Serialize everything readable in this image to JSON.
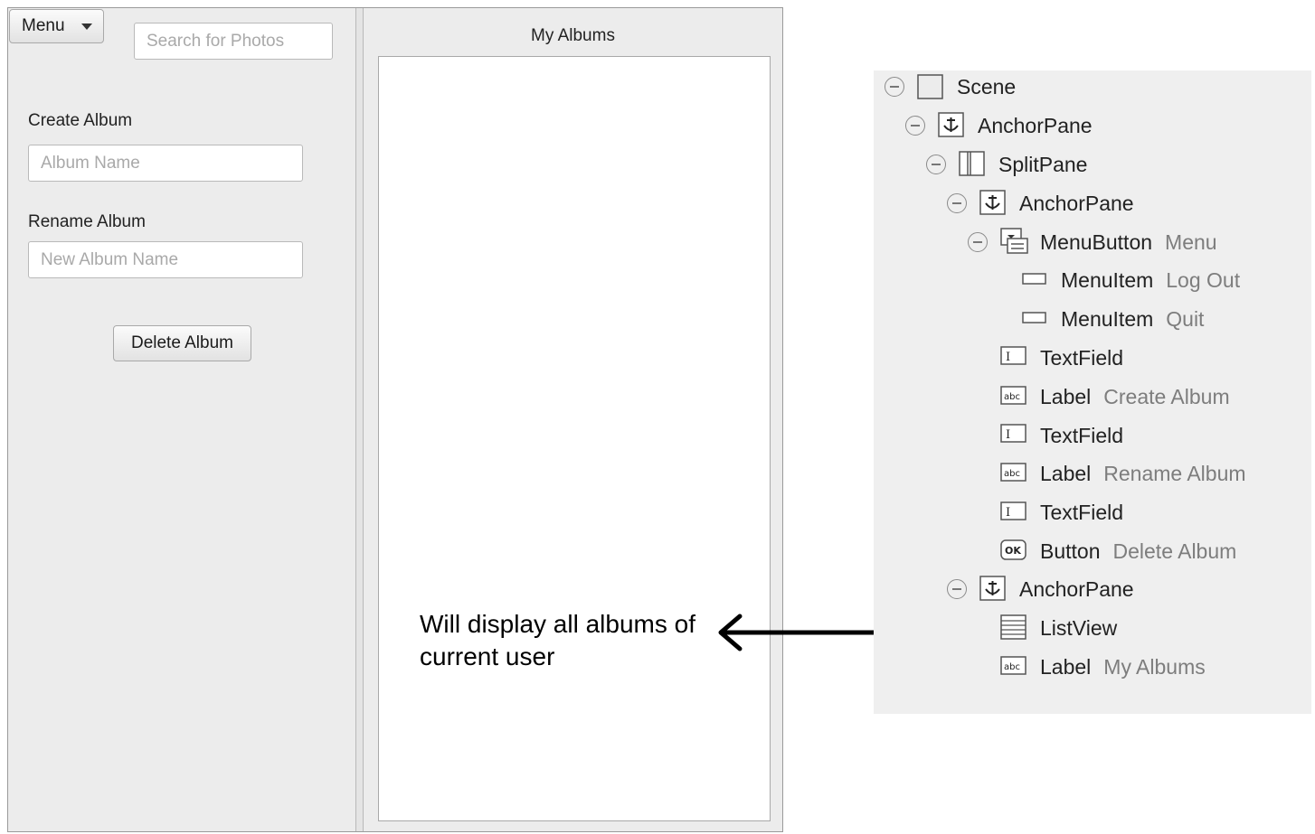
{
  "app": {
    "menu_label": "Menu",
    "search_placeholder": "Search for Photos",
    "create_label": "Create Album",
    "album_name_placeholder": "Album Name",
    "rename_label": "Rename Album",
    "new_album_placeholder": "New Album Name",
    "delete_label": "Delete Album",
    "albums_title": "My Albums"
  },
  "annotation": {
    "line1": "Will display all albums of",
    "line2": "current user"
  },
  "hierarchy": {
    "rows": [
      {
        "name": "Scene",
        "sub": ""
      },
      {
        "name": "AnchorPane",
        "sub": ""
      },
      {
        "name": "SplitPane",
        "sub": ""
      },
      {
        "name": "AnchorPane",
        "sub": ""
      },
      {
        "name": "MenuButton",
        "sub": "Menu"
      },
      {
        "name": "MenuItem",
        "sub": "Log Out"
      },
      {
        "name": "MenuItem",
        "sub": "Quit"
      },
      {
        "name": "TextField",
        "sub": ""
      },
      {
        "name": "Label",
        "sub": "Create Album"
      },
      {
        "name": "TextField",
        "sub": ""
      },
      {
        "name": "Label",
        "sub": "Rename Album"
      },
      {
        "name": "TextField",
        "sub": ""
      },
      {
        "name": "Button",
        "sub": "Delete Album"
      },
      {
        "name": "AnchorPane",
        "sub": ""
      },
      {
        "name": "ListView",
        "sub": ""
      },
      {
        "name": "Label",
        "sub": "My Albums"
      }
    ]
  }
}
